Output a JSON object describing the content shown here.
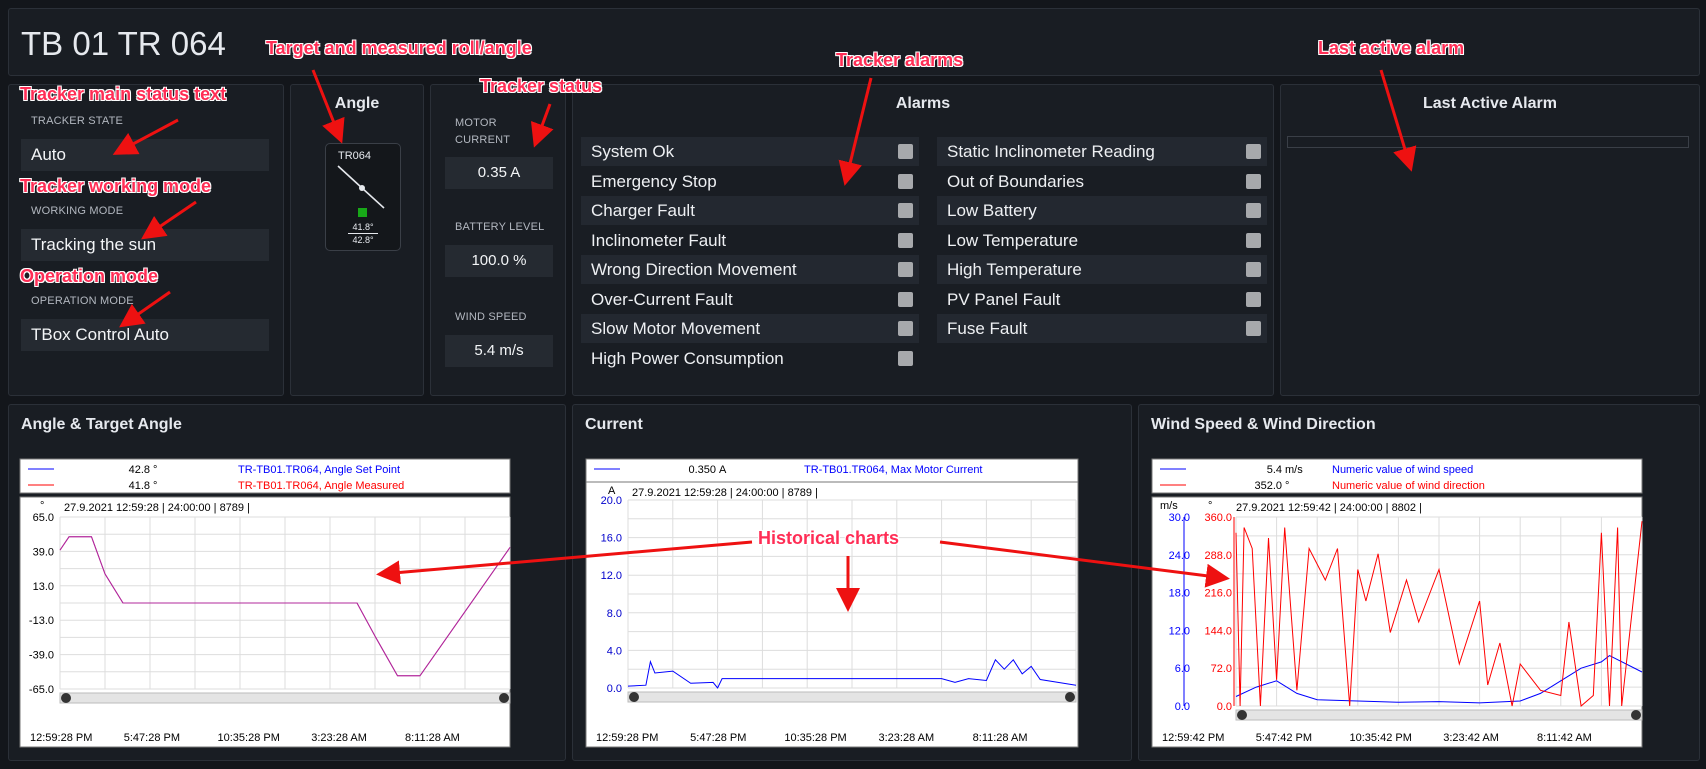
{
  "header": {
    "title": "TB 01 TR 064"
  },
  "status": {
    "tracker_state_label": "TRACKER STATE",
    "tracker_state_value": "Auto",
    "working_mode_label": "WORKING MODE",
    "working_mode_value": "Tracking the sun",
    "operation_mode_label": "OPERATION MODE",
    "operation_mode_value": "TBox Control Auto"
  },
  "angle": {
    "title": "Angle",
    "tracker_id": "TR064",
    "target": "41.8°",
    "measured": "42.8°"
  },
  "metrics": {
    "motor_current_label_1": "MOTOR",
    "motor_current_label_2": "CURRENT",
    "motor_current_value": "0.35 A",
    "battery_label": "BATTERY LEVEL",
    "battery_value": "100.0 %",
    "wind_label": "WIND SPEED",
    "wind_value": "5.4 m/s"
  },
  "alarms": {
    "title": "Alarms",
    "left": [
      "System Ok",
      "Emergency Stop",
      "Charger Fault",
      "Inclinometer Fault",
      "Wrong Direction Movement",
      "Over-Current Fault",
      "Slow Motor Movement",
      "High Power Consumption"
    ],
    "right": [
      "Static Inclinometer Reading",
      "Out of Boundaries",
      "Low Battery",
      "Low Temperature",
      "High Temperature",
      "PV Panel Fault",
      "Fuse Fault"
    ]
  },
  "last_alarm": {
    "title": "Last Active Alarm"
  },
  "annotations": {
    "target_angle": "Target and measured roll/angle",
    "tracker_status": "Tracker status",
    "tracker_alarms": "Tracker alarms",
    "last_alarm": "Last active alarm",
    "main_status": "Tracker main status text",
    "working_mode": "Tracker working mode",
    "operation_mode": "Operation mode",
    "historical": "Historical charts"
  },
  "chart_data": [
    {
      "type": "line",
      "title": "Angle & Target Angle",
      "unit": "°",
      "header": "27.9.2021 12:59:28 | 24:00:00 | 8789 |",
      "legend": [
        {
          "value": "42.8",
          "unit": "°",
          "name": "TR-TB01.TR064, Angle Set Point",
          "color": "#0000ff"
        },
        {
          "value": "41.8",
          "unit": "°",
          "name": "TR-TB01.TR064, Angle Measured",
          "color": "#ff0000"
        }
      ],
      "y_ticks": [
        "65.0",
        "39.0",
        "13.0",
        "-13.0",
        "-39.0",
        "-65.0"
      ],
      "ylim": [
        -65,
        65
      ],
      "x_ticks": [
        "12:59:28 PM",
        "5:47:28 PM",
        "10:35:28 PM",
        "3:23:28 AM",
        "8:11:28 AM"
      ],
      "series": [
        {
          "name": "TR-TB01.TR064, Angle Set Point",
          "color": "#0000ff",
          "points": [
            [
              0,
              40
            ],
            [
              0.02,
              50
            ],
            [
              0.07,
              50
            ],
            [
              0.1,
              22
            ],
            [
              0.14,
              0
            ],
            [
              0.66,
              0
            ],
            [
              0.7,
              -25
            ],
            [
              0.75,
              -55
            ],
            [
              0.8,
              -55
            ],
            [
              1,
              42
            ]
          ]
        },
        {
          "name": "TR-TB01.TR064, Angle Measured",
          "color": "#ff0000",
          "points": [
            [
              0,
              40
            ],
            [
              0.02,
              50
            ],
            [
              0.07,
              50
            ],
            [
              0.1,
              22
            ],
            [
              0.14,
              0
            ],
            [
              0.66,
              0
            ],
            [
              0.7,
              -25
            ],
            [
              0.75,
              -55
            ],
            [
              0.8,
              -55
            ],
            [
              1,
              42
            ]
          ]
        }
      ]
    },
    {
      "type": "line",
      "title": "Current",
      "unit": "A",
      "header": "27.9.2021 12:59:28 | 24:00:00 | 8789 |",
      "legend": [
        {
          "value": "0.350",
          "unit": "A",
          "name": "TR-TB01.TR064, Max Motor Current",
          "color": "#0000ff"
        }
      ],
      "y_ticks": [
        "20.0",
        "16.0",
        "12.0",
        "8.0",
        "4.0",
        "0.0"
      ],
      "ylim": [
        0,
        20
      ],
      "x_ticks": [
        "12:59:28 PM",
        "5:47:28 PM",
        "10:35:28 PM",
        "3:23:28 AM",
        "8:11:28 AM"
      ],
      "series": [
        {
          "name": "TR-TB01.TR064, Max Motor Current",
          "color": "#0000ff",
          "points": [
            [
              0,
              0.2
            ],
            [
              0.04,
              0.3
            ],
            [
              0.05,
              2.8
            ],
            [
              0.06,
              1.6
            ],
            [
              0.1,
              1.8
            ],
            [
              0.14,
              0.5
            ],
            [
              0.19,
              0.6
            ],
            [
              0.2,
              0
            ],
            [
              0.21,
              1
            ],
            [
              0.7,
              1
            ],
            [
              0.73,
              0.6
            ],
            [
              0.76,
              1
            ],
            [
              0.8,
              0.8
            ],
            [
              0.82,
              3
            ],
            [
              0.84,
              2
            ],
            [
              0.86,
              3
            ],
            [
              0.88,
              1.5
            ],
            [
              0.9,
              2.3
            ],
            [
              0.92,
              0.9
            ],
            [
              0.96,
              0.6
            ],
            [
              1,
              0.3
            ]
          ]
        }
      ]
    },
    {
      "type": "line",
      "title": "Wind Speed & Wind Direction",
      "header": "27.9.2021 12:59:42 | 24:00:00 | 8802 |",
      "legend": [
        {
          "value": "5.4",
          "unit": "m/s",
          "name": "Numeric value of wind speed",
          "color": "#0000ff"
        },
        {
          "value": "352.0",
          "unit": "°",
          "name": "Numeric value of wind direction",
          "color": "#ff0000"
        }
      ],
      "y_ticks_left": [
        "30.0",
        "24.0",
        "18.0",
        "12.0",
        "6.0",
        "0.0"
      ],
      "y_ticks_right": [
        "360.0",
        "288.0",
        "216.0",
        "144.0",
        "72.0",
        "0.0"
      ],
      "y_units": [
        "m/s",
        "°"
      ],
      "x_ticks": [
        "12:59:42 PM",
        "5:47:42 PM",
        "10:35:42 PM",
        "3:23:42 AM",
        "8:11:42 AM"
      ],
      "series": [
        {
          "name": "Numeric value of wind speed",
          "color": "#0000ff",
          "points": [
            [
              0,
              1.5
            ],
            [
              0.05,
              3
            ],
            [
              0.1,
              4
            ],
            [
              0.15,
              2
            ],
            [
              0.2,
              1
            ],
            [
              0.3,
              0.8
            ],
            [
              0.4,
              0.6
            ],
            [
              0.5,
              0.7
            ],
            [
              0.6,
              0.5
            ],
            [
              0.7,
              0.8
            ],
            [
              0.75,
              2
            ],
            [
              0.8,
              4
            ],
            [
              0.85,
              6
            ],
            [
              0.9,
              7
            ],
            [
              0.92,
              8
            ],
            [
              1,
              5.4
            ]
          ]
        },
        {
          "name": "Numeric value of wind direction",
          "color": "#ff0000",
          "points": [
            [
              0,
              330
            ],
            [
              0.01,
              0
            ],
            [
              0.02,
              340
            ],
            [
              0.04,
              300
            ],
            [
              0.06,
              0
            ],
            [
              0.08,
              320
            ],
            [
              0.1,
              50
            ],
            [
              0.12,
              340
            ],
            [
              0.15,
              30
            ],
            [
              0.18,
              300
            ],
            [
              0.22,
              240
            ],
            [
              0.25,
              300
            ],
            [
              0.28,
              0
            ],
            [
              0.3,
              260
            ],
            [
              0.32,
              200
            ],
            [
              0.35,
              290
            ],
            [
              0.38,
              140
            ],
            [
              0.42,
              240
            ],
            [
              0.45,
              160
            ],
            [
              0.5,
              260
            ],
            [
              0.55,
              80
            ],
            [
              0.6,
              200
            ],
            [
              0.62,
              40
            ],
            [
              0.65,
              120
            ],
            [
              0.68,
              0
            ],
            [
              0.7,
              80
            ],
            [
              0.75,
              30
            ],
            [
              0.8,
              20
            ],
            [
              0.82,
              160
            ],
            [
              0.85,
              0
            ],
            [
              0.88,
              20
            ],
            [
              0.9,
              330
            ],
            [
              0.92,
              0
            ],
            [
              0.94,
              340
            ],
            [
              0.95,
              0
            ],
            [
              1,
              352
            ]
          ]
        }
      ]
    }
  ]
}
